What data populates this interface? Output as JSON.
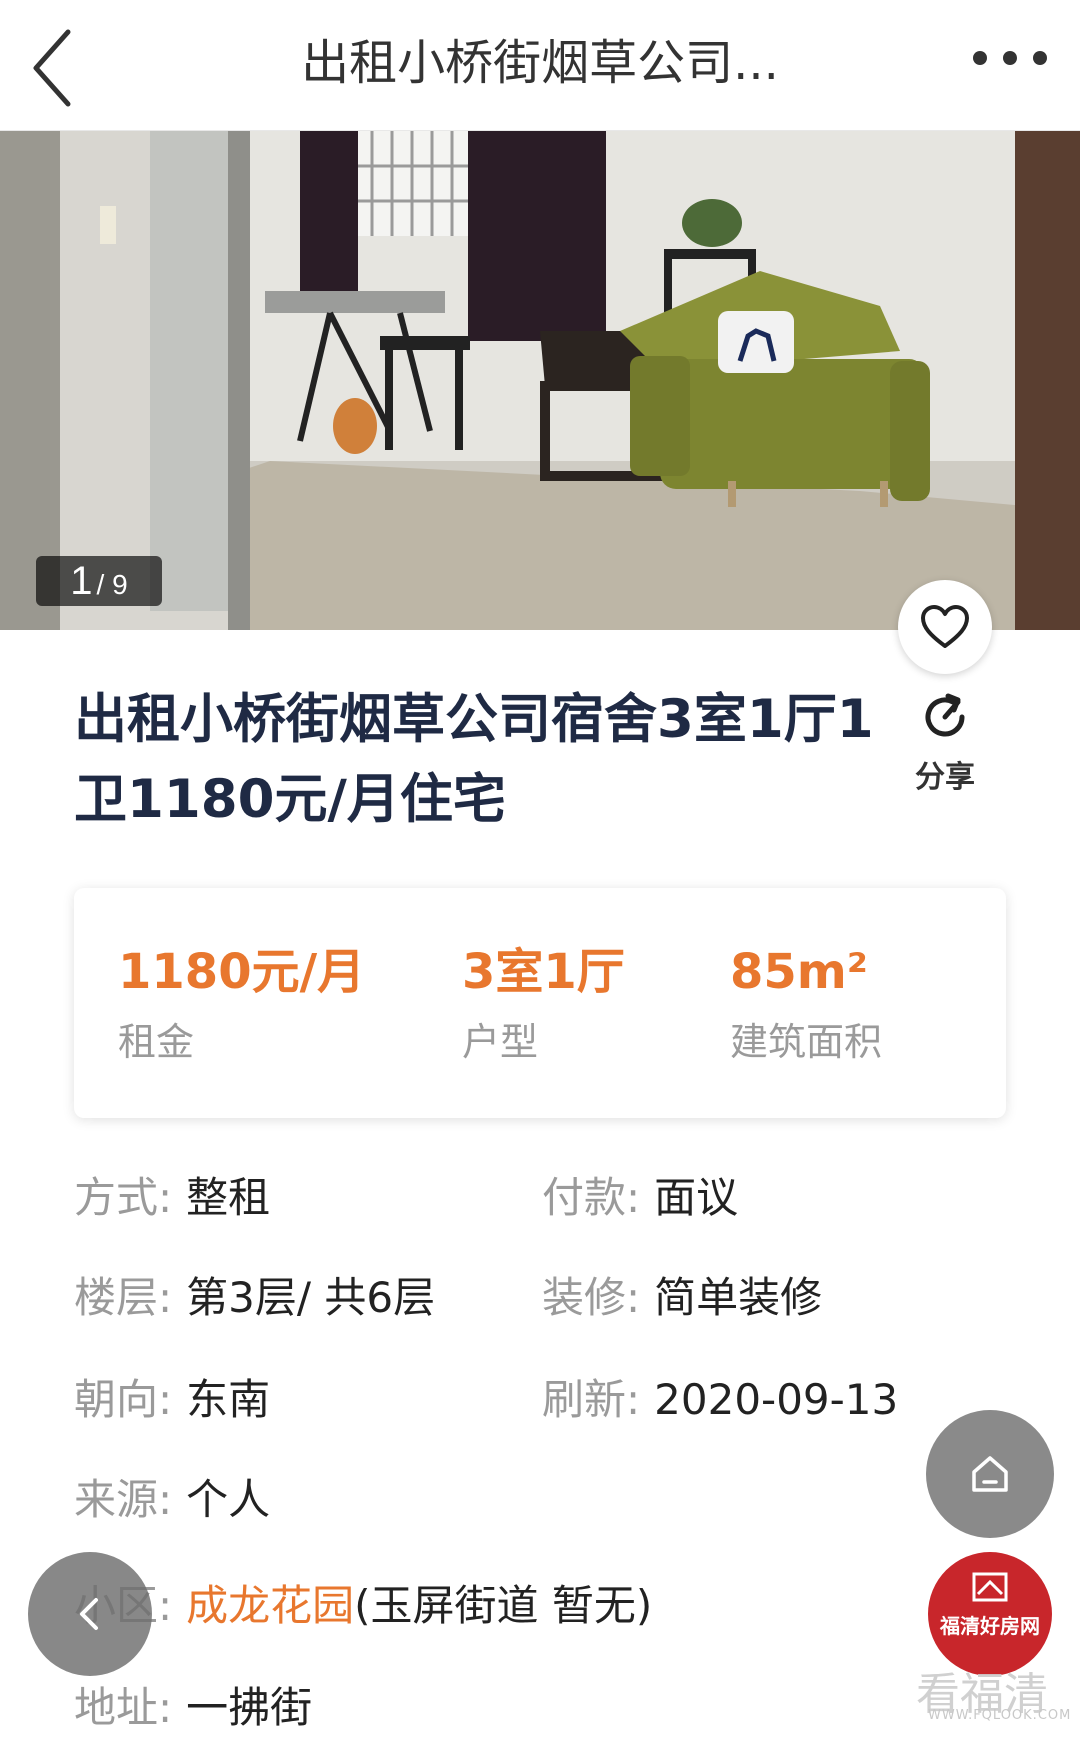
{
  "header": {
    "title": "出租小桥街烟草公司...",
    "back_icon": "chevron-left-icon",
    "more_icon": "more-dots-icon"
  },
  "gallery": {
    "current": "1",
    "total": "/ 9",
    "favorite_icon": "heart-icon"
  },
  "listing": {
    "headline": "出租小桥街烟草公司宿舍3室1厅1卫1180元/月住宅",
    "share_label": "分享",
    "share_icon": "share-refresh-icon"
  },
  "summary": {
    "rent_value": "1180元/月",
    "rent_label": "租金",
    "layout_value": "3室1厅",
    "layout_label": "户型",
    "area_value": "85m²",
    "area_label": "建筑面积"
  },
  "details": {
    "mode_key": "方式:",
    "mode_val": "整租",
    "pay_key": "付款:",
    "pay_val": "面议",
    "floor_key": "楼层:",
    "floor_val": "第3层/ 共6层",
    "deco_key": "装修:",
    "deco_val": "简单装修",
    "facing_key": "朝向:",
    "facing_val": "东南",
    "refresh_key": "刷新:",
    "refresh_val": "2020-09-13",
    "source_key": "来源:",
    "source_val": "个人",
    "community_key": "小区:",
    "community_link": "成龙花园",
    "community_extra": "(玉屏街道 暂无)",
    "address_key": "地址:",
    "address_val": "一拂街"
  },
  "overlay": {
    "logo_text": "福清好房网",
    "watermark": "看福清",
    "watermark_url": "WWW.FQLOOK.COM"
  },
  "colors": {
    "accent": "#e8772e",
    "headline": "#1f2a44",
    "label": "#9a9a9a",
    "logo_red": "#c8262b"
  }
}
